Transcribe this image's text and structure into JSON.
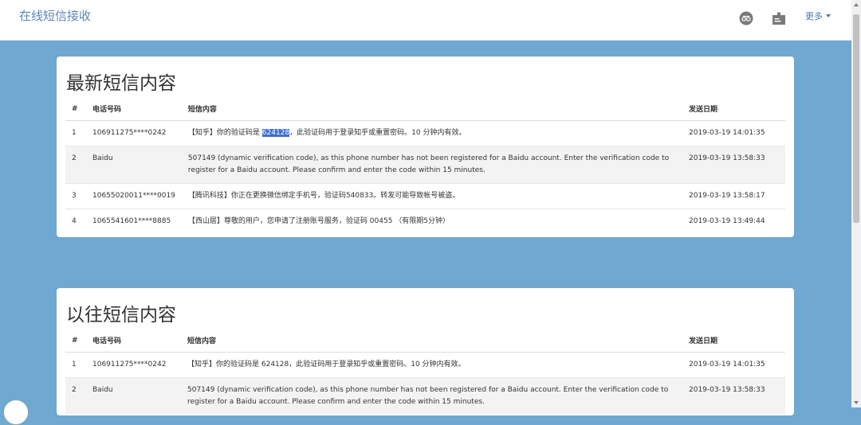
{
  "navbar": {
    "brand": "在线短信接收",
    "more_label": "更多"
  },
  "latest": {
    "title": "最新短信内容",
    "headers": [
      "#",
      "电话号码",
      "短信内容",
      "发送日期"
    ],
    "rows": [
      {
        "idx": "1",
        "phone": "106911275****0242",
        "content_before": "【知乎】你的验证码是 ",
        "content_highlight": "624128",
        "content_after": "，此验证码用于登录知乎或重置密码。10 分钟内有效。",
        "date": "2019-03-19 14:01:35"
      },
      {
        "idx": "2",
        "phone": "Baidu",
        "content": "507149 (dynamic verification code), as this phone number has not been registered for a Baidu account. Enter the verification code to register for a Baidu account. Please confirm and enter the code within 15 minutes.",
        "date": "2019-03-19 13:58:33"
      },
      {
        "idx": "3",
        "phone": "10655020011****0019",
        "content": "【腾讯科技】你正在更换微信绑定手机号，验证码540833。转发可能导致帐号被盗。",
        "date": "2019-03-19 13:58:17"
      },
      {
        "idx": "4",
        "phone": "1065541601****8885",
        "content": "【西山居】尊敬的用户，您申请了注册账号服务，验证码 00455 （有限期5分钟）",
        "date": "2019-03-19 13:49:44"
      }
    ]
  },
  "history": {
    "title": "以往短信内容",
    "headers": [
      "#",
      "电话号码",
      "短信内容",
      "发送日期"
    ],
    "rows": [
      {
        "idx": "1",
        "phone": "106911275****0242",
        "content": "【知乎】你的验证码是 624128，此验证码用于登录知乎或重置密码。10 分钟内有效。",
        "date": "2019-03-19 14:01:35"
      },
      {
        "idx": "2",
        "phone": "Baidu",
        "content": "507149 (dynamic verification code), as this phone number has not been registered for a Baidu account. Enter the verification code to register for a Baidu account. Please confirm and enter the code within 15 minutes.",
        "date": "2019-03-19 13:58:33"
      }
    ]
  },
  "icons": {
    "nav_icon_1": "user-circle-icon",
    "nav_icon_2": "id-card-icon",
    "caret": "caret-down-icon"
  }
}
